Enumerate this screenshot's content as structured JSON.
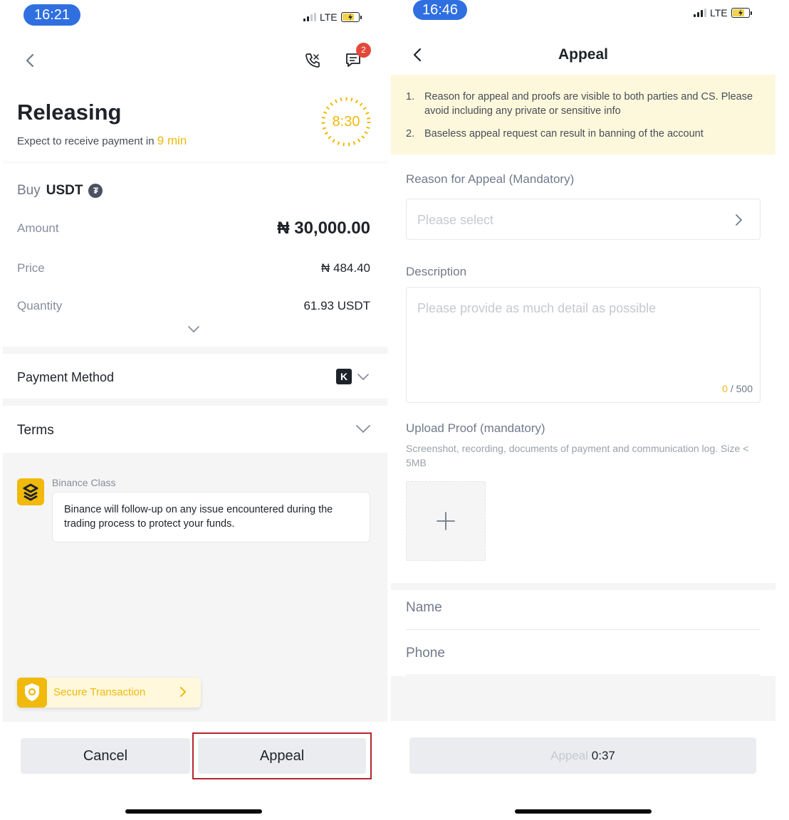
{
  "left": {
    "status_time": "16:21",
    "network": "LTE",
    "chat_badge": "2",
    "title": "Releasing",
    "expect_prefix": "Expect to receive payment in",
    "expect_value": "9 min",
    "timer": "8:30",
    "buy_label": "Buy",
    "buy_asset": "USDT",
    "rows": [
      {
        "label": "Amount",
        "value": "₦ 30,000.00"
      },
      {
        "label": "Price",
        "value": "₦ 484.40"
      },
      {
        "label": "Quantity",
        "value": "61.93 USDT"
      }
    ],
    "payment_method_label": "Payment Method",
    "terms_label": "Terms",
    "class_label": "Binance Class",
    "class_message": "Binance will follow-up on any issue encountered during the trading process to protect your funds.",
    "secure_label": "Secure Transaction",
    "cancel_label": "Cancel",
    "appeal_label": "Appeal"
  },
  "right": {
    "status_time": "16:46",
    "network": "LTE",
    "title": "Appeal",
    "notices": [
      {
        "num": "1.",
        "text": "Reason for appeal and proofs are visible to both parties and CS. Please avoid including any private or sensitive info"
      },
      {
        "num": "2.",
        "text": "Baseless appeal request can result in banning of the account"
      }
    ],
    "reason_label": "Reason for Appeal (Mandatory)",
    "reason_placeholder": "Please select",
    "description_label": "Description",
    "description_placeholder": "Please provide as much detail as possible",
    "counter_current": "0",
    "counter_max": "/ 500",
    "upload_label": "Upload Proof (mandatory)",
    "upload_hint": "Screenshot, recording, documents of payment and communication log. Size < 5MB",
    "name_label": "Name",
    "phone_label": "Phone",
    "submit_label": "Appeal",
    "submit_countdown": "0:37"
  },
  "colors": {
    "accent_yellow": "#f0b90b",
    "status_pill": "#2f6fe0",
    "highlight_red": "#b3262d",
    "notice_bg": "#fdf8dc",
    "badge_red": "#e3483a"
  },
  "icons": [
    "back-chevron-icon",
    "phone-call-icon",
    "chat-icon",
    "tether-icon",
    "expand-chevron-icon",
    "kuda-bank-icon",
    "binance-class-icon",
    "secure-shield-icon",
    "chevron-right-icon",
    "plus-icon",
    "signal-icon",
    "battery-icon"
  ]
}
